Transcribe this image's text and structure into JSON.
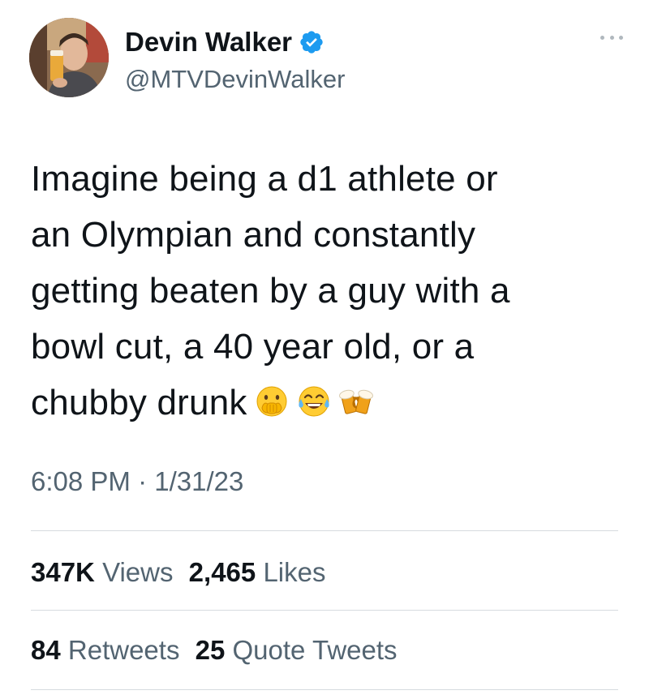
{
  "author": {
    "display_name": "Devin Walker",
    "handle": "@MTVDevinWalker",
    "verified": true
  },
  "tweet": {
    "text_lines": [
      "Imagine being a d1 athlete or",
      "an Olympian and constantly",
      "getting beaten by a guy with a",
      "bowl cut, a 40 year old, or a",
      "chubby drunk"
    ],
    "emojis": [
      "face-with-hand-over-mouth",
      "tears-of-joy",
      "clinking-beer-mugs"
    ],
    "time": "6:08 PM",
    "separator": "·",
    "date": "1/31/23"
  },
  "stats": {
    "views_count": "347K",
    "views_label": "Views",
    "likes_count": "2,465",
    "likes_label": "Likes",
    "retweets_count": "84",
    "retweets_label": "Retweets",
    "quotes_count": "25",
    "quotes_label": "Quote Tweets"
  },
  "colors": {
    "text_primary": "#0f1419",
    "text_secondary": "#536471",
    "verified_blue": "#1d9bf0",
    "divider": "#d6dbdf"
  }
}
